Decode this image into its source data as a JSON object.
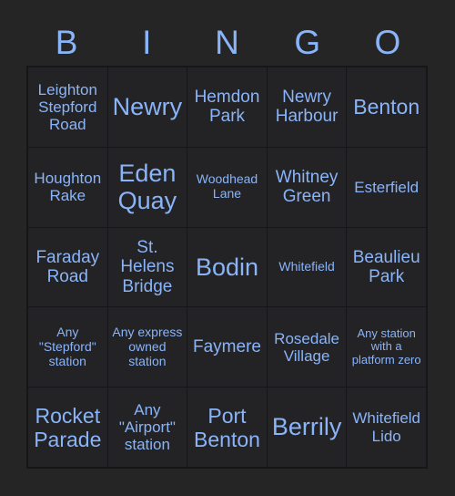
{
  "header": {
    "letters": [
      "B",
      "I",
      "N",
      "G",
      "O"
    ]
  },
  "colors": {
    "page_background": "#252526",
    "cell_background": "#232326",
    "grid_line": "#16161a",
    "text": "#8ab4f8"
  },
  "grid": {
    "columns": 5,
    "rows": 5,
    "cells": [
      {
        "text": "Leighton Stepford Road",
        "size": "sm"
      },
      {
        "text": "Newry",
        "size": "xl"
      },
      {
        "text": "Hemdon Park",
        "size": "md"
      },
      {
        "text": "Newry Harbour",
        "size": "md"
      },
      {
        "text": "Benton",
        "size": "lg"
      },
      {
        "text": "Houghton Rake",
        "size": "sm"
      },
      {
        "text": "Eden Quay",
        "size": "xl"
      },
      {
        "text": "Woodhead Lane",
        "size": "xs"
      },
      {
        "text": "Whitney Green",
        "size": "md"
      },
      {
        "text": "Esterfield",
        "size": "sm"
      },
      {
        "text": "Faraday Road",
        "size": "md"
      },
      {
        "text": "St. Helens Bridge",
        "size": "md"
      },
      {
        "text": "Bodin",
        "size": "xl"
      },
      {
        "text": "Whitefield",
        "size": "xs"
      },
      {
        "text": "Beaulieu Park",
        "size": "md"
      },
      {
        "text": "Any \"Stepford\" station",
        "size": "xs"
      },
      {
        "text": "Any express owned station",
        "size": "xs"
      },
      {
        "text": "Faymere",
        "size": "md"
      },
      {
        "text": "Rosedale Village",
        "size": "sm"
      },
      {
        "text": "Any station with a platform zero",
        "size": "xxs"
      },
      {
        "text": "Rocket Parade",
        "size": "lg"
      },
      {
        "text": "Any \"Airport\" station",
        "size": "sm"
      },
      {
        "text": "Port Benton",
        "size": "lg"
      },
      {
        "text": "Berrily",
        "size": "xl"
      },
      {
        "text": "Whitefield Lido",
        "size": "sm"
      }
    ]
  }
}
